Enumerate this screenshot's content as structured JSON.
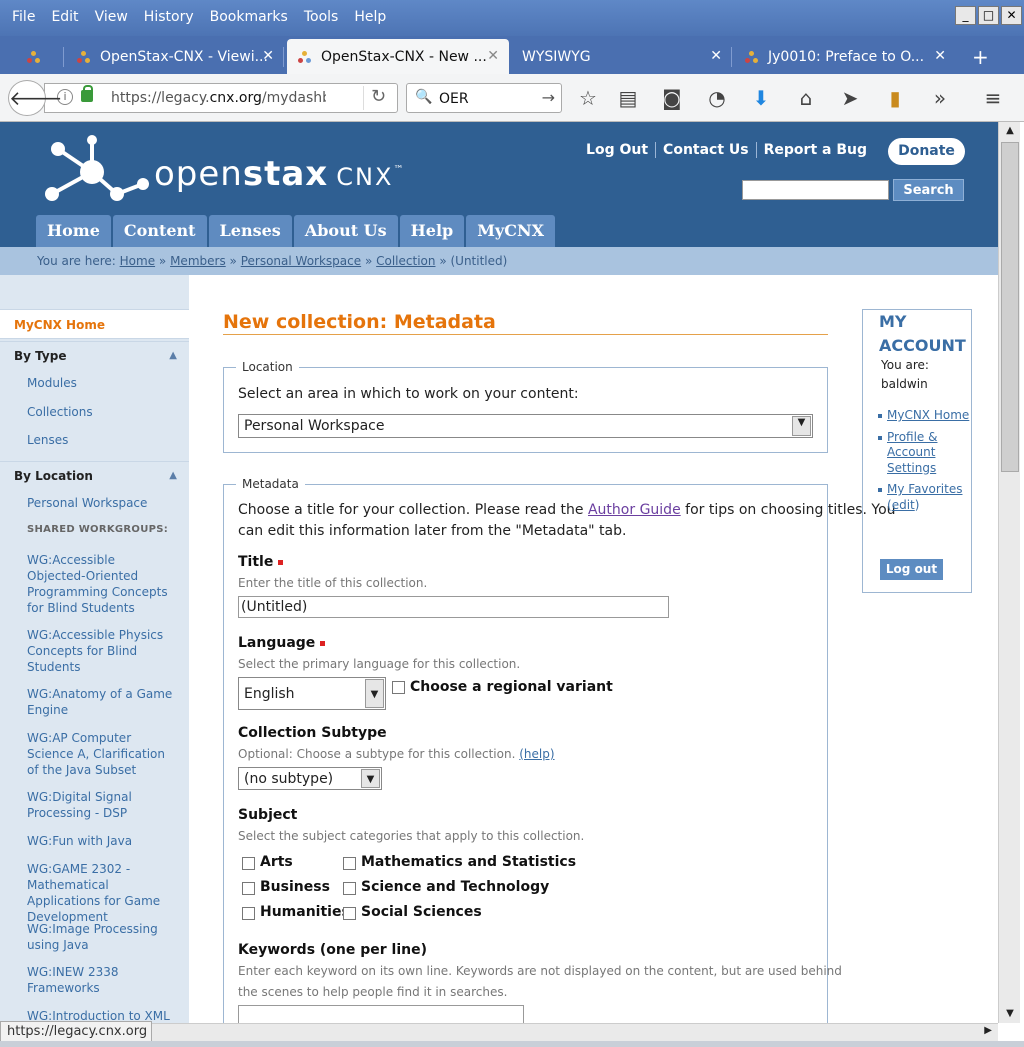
{
  "browser": {
    "menu": [
      "File",
      "Edit",
      "View",
      "History",
      "Bookmarks",
      "Tools",
      "Help"
    ],
    "window_controls": [
      "_",
      "□",
      "✕"
    ],
    "tabs": [
      {
        "label": ""
      },
      {
        "label": "OpenStax-CNX - Viewi..."
      },
      {
        "label": "OpenStax-CNX - New ..."
      },
      {
        "label": "WYSIWYG"
      },
      {
        "label": "Jy0010: Preface to O..."
      }
    ],
    "new_tab": "+",
    "url_prefix": "https://legacy.",
    "url_domain": "cnx.org",
    "url_path": "/mydashboa",
    "search_value": "OER",
    "status_url": "https://legacy.cnx.org"
  },
  "site": {
    "logo_word_light": "open",
    "logo_word_bold": "stax",
    "logo_suffix": "CNX",
    "logo_tm": "™",
    "top_links": [
      "Log Out",
      "Contact Us",
      "Report a Bug"
    ],
    "donate": "Donate",
    "search_button": "Search",
    "nav": [
      "Home",
      "Content",
      "Lenses",
      "About Us",
      "Help",
      "MyCNX"
    ],
    "breadcrumb_prefix": "You are here:",
    "breadcrumb": [
      "Home",
      "Members",
      "Personal Workspace",
      "Collection"
    ],
    "breadcrumb_sep": "»",
    "breadcrumb_current": "(Untitled)"
  },
  "sidebar": {
    "home": "MyCNX Home",
    "by_type": "By Type",
    "types": [
      "Modules",
      "Collections",
      "Lenses"
    ],
    "by_location": "By Location",
    "personal": "Personal Workspace",
    "shared_header": "SHARED WORKGROUPS:",
    "workgroups": [
      "WG:Accessible Objected-Oriented Programming Concepts for Blind Students",
      "WG:Accessible Physics Concepts for Blind Students",
      "WG:Anatomy of a Game Engine",
      "WG:AP Computer Science A, Clarification of the Java Subset",
      "WG:Digital Signal Processing - DSP",
      "WG:Fun with Java",
      "WG:GAME 2302 - Mathematical Applications for Game Development",
      "WG:Image Processing using Java",
      "WG:INEW 2338 Frameworks",
      "WG:Introduction to XML"
    ]
  },
  "main": {
    "title": "New collection: Metadata",
    "location_legend": "Location",
    "location_prompt": "Select an area in which to work on your content:",
    "location_value": "Personal Workspace",
    "metadata_legend": "Metadata",
    "intro_1": "Choose a title for your collection. Please read the ",
    "intro_link": "Author Guide",
    "intro_2": " for tips on choosing titles. You",
    "intro_3": "can edit this information later from the \"Metadata\" tab.",
    "title_label": "Title",
    "title_hint": "Enter the title of this collection.",
    "title_value": "(Untitled)",
    "language_label": "Language",
    "language_hint": "Select the primary language for this collection.",
    "language_value": "English",
    "regional_label": "Choose a regional variant",
    "subtype_label": "Collection Subtype",
    "subtype_hint": "Optional: Choose a subtype for this collection.",
    "subtype_help": "(help)",
    "subtype_value": "(no subtype)",
    "subject_label": "Subject",
    "subject_hint": "Select the subject categories that apply to this collection.",
    "subjects_left": [
      "Arts",
      "Business",
      "Humanities"
    ],
    "subjects_right": [
      "Mathematics and Statistics",
      "Science and Technology",
      "Social Sciences"
    ],
    "keywords_label": "Keywords (one per line)",
    "keywords_hint_1": "Enter each keyword on its own line. Keywords are not displayed on the content, but are used behind",
    "keywords_hint_2": "the scenes to help people find it in searches."
  },
  "account": {
    "title_1": "MY",
    "title_2": "ACCOUNT",
    "you_are": "You are:",
    "username": "baldwin",
    "link_home": "MyCNX Home",
    "link_profile": "Profile & Account Settings",
    "link_fav": "My Favorites",
    "fav_edit": "edit",
    "logout": "Log out"
  },
  "colors": {
    "header_blue": "#2f5f92",
    "accent_orange": "#e5740b",
    "link_blue": "#3a6ea5"
  }
}
